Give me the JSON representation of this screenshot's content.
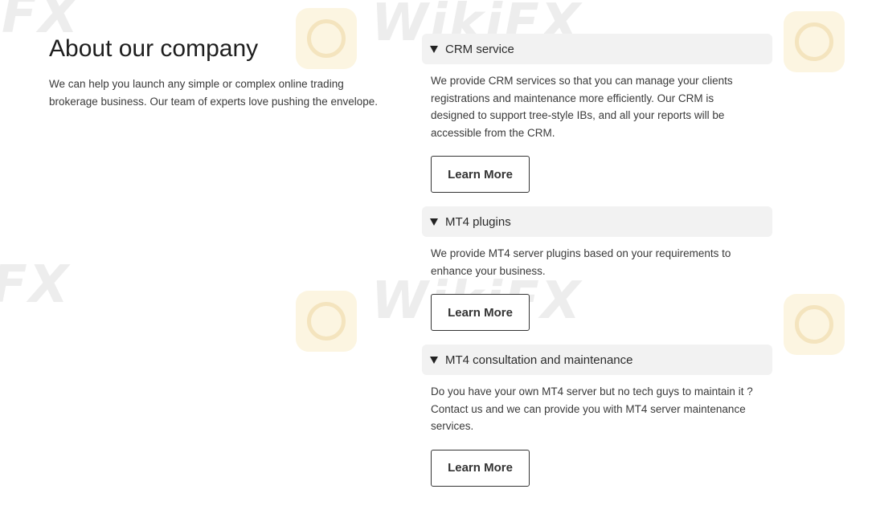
{
  "about": {
    "title": "About our company",
    "intro": "We can help you launch any simple or complex online trading brokerage business. Our team of experts love pushing the envelope."
  },
  "sections": [
    {
      "title": "CRM service",
      "description": "We provide CRM services so that you can manage your clients registrations and maintenance more efficiently. Our CRM is designed to support tree-style IBs, and all your reports will be accessible from the CRM.",
      "button": "Learn More"
    },
    {
      "title": "MT4 plugins",
      "description": "We provide MT4 server plugins based on your requirements to enhance your business.",
      "button": "Learn More"
    },
    {
      "title": "MT4 consultation and maintenance",
      "description": "Do you have your own MT4 server but no tech guys to maintain it ? Contact us and we can provide you with MT4 server maintenance services.",
      "button": "Learn More"
    }
  ],
  "watermark": {
    "text": "WikiFX",
    "fragment": "FX"
  }
}
